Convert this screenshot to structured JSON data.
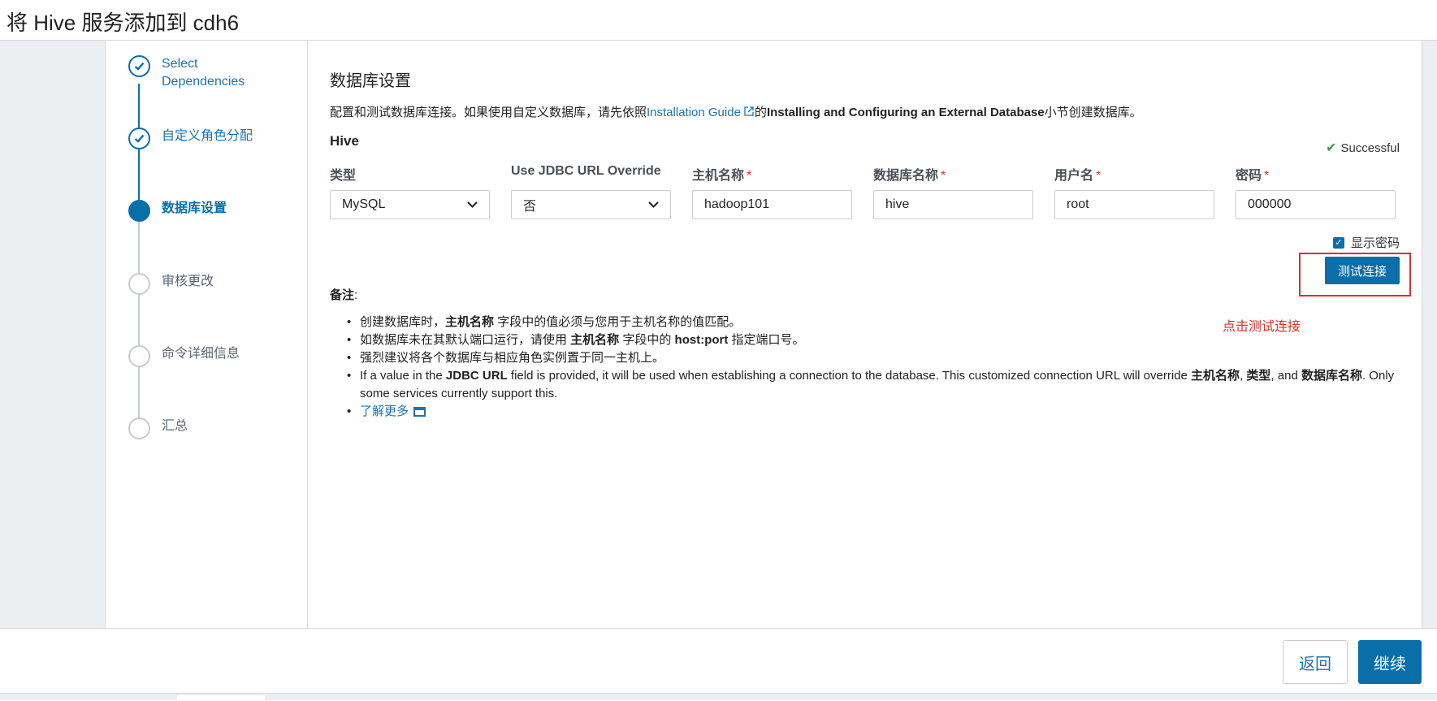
{
  "window": {
    "title": "将 Hive 服务添加到 cdh6"
  },
  "wizard": {
    "steps": [
      {
        "label": "Select Dependencies",
        "state": "done"
      },
      {
        "label": "自定义角色分配",
        "state": "done"
      },
      {
        "label": "数据库设置",
        "state": "active"
      },
      {
        "label": "审核更改",
        "state": "todo"
      },
      {
        "label": "命令详细信息",
        "state": "todo"
      },
      {
        "label": "汇总",
        "state": "todo"
      }
    ]
  },
  "main": {
    "section_title": "数据库设置",
    "description": {
      "prefix": "配置和测试数据库连接。如果使用自定义数据库，请先依照",
      "link": "Installation Guide",
      "mid": "的",
      "bold": "Installing and Configuring an External Database",
      "suffix": "小节创建数据库。"
    },
    "service_name": "Hive",
    "status": "Successful",
    "fields": {
      "type": {
        "label": "类型",
        "value": "MySQL"
      },
      "jdbc": {
        "label": "Use JDBC URL Override",
        "value": "否"
      },
      "host": {
        "label": "主机名称",
        "value": "hadoop101",
        "required": "*"
      },
      "db": {
        "label": "数据库名称",
        "value": "hive",
        "required": "*"
      },
      "user": {
        "label": "用户名",
        "value": "root",
        "required": "*"
      },
      "password": {
        "label": "密码",
        "value": "000000",
        "required": "*"
      }
    },
    "show_password": {
      "label": "显示密码",
      "checked": true
    },
    "test_button": "测试连接",
    "annotation": "点击测试连接",
    "notes": {
      "title": "备注",
      "colon": ":",
      "item1": {
        "a": "创建数据库时，",
        "b": "主机名称",
        "c": " 字段中的值必须与您用于主机名称的值匹配。"
      },
      "item2": {
        "a": "如数据库未在其默认端口运行，请使用 ",
        "b": "主机名称",
        "c": " 字段中的 ",
        "d": "host:port",
        "e": " 指定端口号。"
      },
      "item3": "强烈建议将各个数据库与相应角色实例置于同一主机上。",
      "item4": {
        "a": "If a value in the ",
        "b": "JDBC URL",
        "c": " field is provided, it will be used when establishing a connection to the database. This customized connection URL will override ",
        "d": "主机名称",
        "e": ", ",
        "f": "类型",
        "g": ", and ",
        "h": "数据库名称",
        "i": ". Only some services currently support this."
      },
      "item5": "了解更多"
    }
  },
  "footer": {
    "back": "返回",
    "next": "继续"
  },
  "colors": {
    "primary": "#0a6fa8",
    "link": "#1a73b5",
    "annotation": "#e0302a",
    "success": "#3c9a3c"
  }
}
